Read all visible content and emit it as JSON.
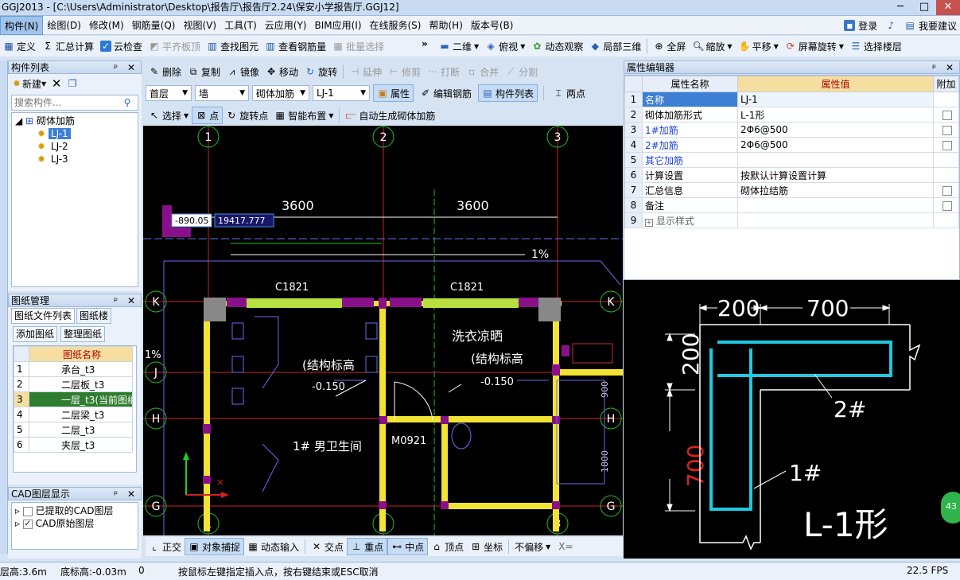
{
  "title_bar": {
    "title": "GGJ2013 - [C:\\Users\\Administrator\\Desktop\\报告厅\\报告厅2.24\\保安小学报告厅.GGJ12]",
    "min": "─",
    "max": "□",
    "close": "✕"
  },
  "menu": {
    "items": [
      "构件(N)",
      "绘图(D)",
      "修改(M)",
      "钢筋量(Q)",
      "视图(V)",
      "工具(T)",
      "云应用(Y)",
      "BIM应用(I)",
      "在线服务(S)",
      "帮助(H)",
      "版本号(B)"
    ],
    "login": "登录",
    "feedback": "我要建议"
  },
  "toolbar1": {
    "items": [
      "定义",
      "汇总计算",
      "云检查",
      "平齐板顶",
      "查找图元",
      "查看钢筋量",
      "批量选择"
    ],
    "more": "»",
    "right_items": [
      "二维",
      "俯视",
      "动态观察",
      "局部三维",
      "全屏",
      "缩放",
      "平移",
      "屏幕旋转",
      "选择楼层"
    ]
  },
  "toolbar2": {
    "items": [
      "删除",
      "复制",
      "镜像",
      "移动",
      "旋转",
      "延伸",
      "修剪",
      "打断",
      "合并",
      "分割"
    ]
  },
  "toolbar3": {
    "floor": "首层",
    "category": "墙",
    "type": "砌体加筋",
    "component": "LJ-1",
    "btn_props": "属性",
    "btn_edit": "编辑钢筋",
    "btn_list": "构件列表",
    "btn_twopoints": "两点"
  },
  "toolbar4": {
    "select": "选择",
    "point": "点",
    "rotate_point": "旋转点",
    "smart": "智能布置",
    "auto": "自动生成砌体加筋"
  },
  "comp_list": {
    "title": "构件列表",
    "new": "新建",
    "search_placeholder": "搜索构件...",
    "root": "砌体加筋",
    "items": [
      "LJ-1",
      "LJ-2",
      "LJ-3"
    ]
  },
  "drawing_mgmt": {
    "title": "图纸管理",
    "tab1": "图纸文件列表",
    "tab2": "图纸楼",
    "add": "添加图纸",
    "organize": "整理图纸",
    "col": "图纸名称",
    "rows": [
      "承台_t3",
      "二层板_t3",
      "一层_t3(当前图纸)",
      "二层梁_t3",
      "二层_t3",
      "夹层_t3"
    ],
    "row_nums": [
      "1",
      "2",
      "3",
      "4",
      "5",
      "6"
    ]
  },
  "cad_layers": {
    "title": "CAD图层显示",
    "items": [
      "已提取的CAD图层",
      "CAD原始图层"
    ]
  },
  "props": {
    "title": "属性编辑器",
    "col_name": "属性名称",
    "col_value": "属性值",
    "col_extra": "附加",
    "rows": [
      {
        "n": "1",
        "name": "名称",
        "value": "LJ-1"
      },
      {
        "n": "2",
        "name": "砌体加筋形式",
        "value": "L-1形"
      },
      {
        "n": "3",
        "name": "1#加筋",
        "value": "2Φ6@500"
      },
      {
        "n": "4",
        "name": "2#加筋",
        "value": "2Φ6@500"
      },
      {
        "n": "5",
        "name": "其它加筋",
        "value": ""
      },
      {
        "n": "6",
        "name": "计算设置",
        "value": "按默认计算设置计算"
      },
      {
        "n": "7",
        "name": "汇总信息",
        "value": "砌体拉结筋"
      },
      {
        "n": "8",
        "name": "备注",
        "value": ""
      },
      {
        "n": "9",
        "name": "显示样式",
        "value": ""
      }
    ]
  },
  "cad": {
    "axis_top": [
      "1",
      "2",
      "3"
    ],
    "axis_side": [
      "K",
      "J",
      "H",
      "G"
    ],
    "dims": [
      "3600",
      "3600"
    ],
    "coord_x": "-890.05",
    "coord_y": "19417.777",
    "slope": "1%",
    "slope_left": "1%",
    "windows": [
      "C1821",
      "C1821"
    ],
    "rooms": [
      "洗衣凉晒",
      "(结构标高",
      "(结构标高",
      "1# 男卫生间"
    ],
    "elev": [
      "-0.150",
      "-0.150"
    ],
    "door": "M0921",
    "right_dims": [
      "900",
      "1800"
    ]
  },
  "preview": {
    "dim_top1": "200",
    "dim_top2": "700",
    "dim_left1": "200",
    "dim_left2": "700",
    "label1": "1#",
    "label2": "2#",
    "shape": "L-1形",
    "badge": "43"
  },
  "bottombar": {
    "items": [
      "正交",
      "对象捕捉",
      "动态输入",
      "交点",
      "重点",
      "中点",
      "顶点",
      "坐标",
      "不偏移"
    ],
    "xfield": "X="
  },
  "status": {
    "floor_height": "层高:3.6m",
    "bottom_elev": "底标高:-0.03m",
    "zero": "0",
    "hint": "按鼠标左键指定插入点，按右键结束或ESC取消",
    "fps": "22.5 FPS"
  }
}
